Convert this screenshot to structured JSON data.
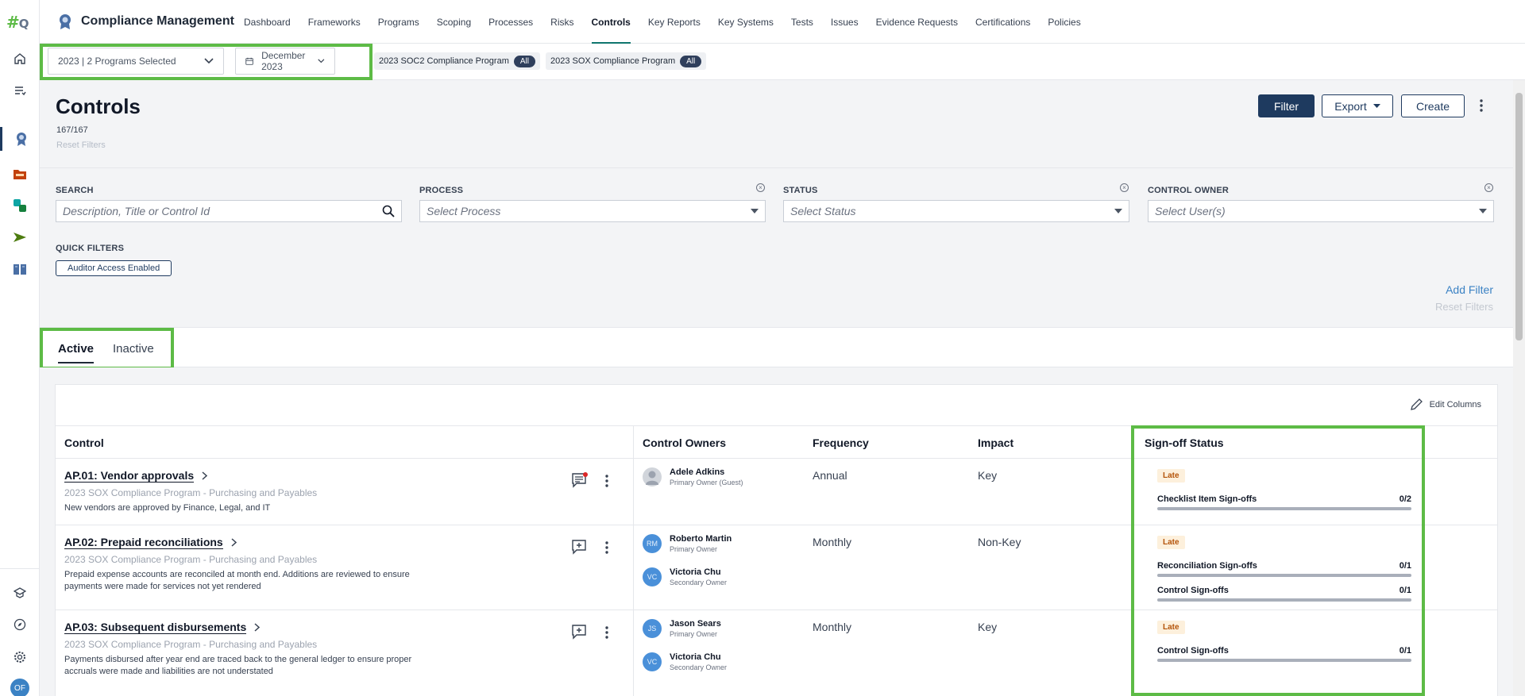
{
  "app": {
    "title": "Compliance Management",
    "nav": [
      "Dashboard",
      "Frameworks",
      "Programs",
      "Scoping",
      "Processes",
      "Risks",
      "Controls",
      "Key Reports",
      "Key Systems",
      "Tests",
      "Issues",
      "Evidence Requests",
      "Certifications",
      "Policies"
    ],
    "active_nav": "Controls",
    "user_initials": "OF"
  },
  "program_bar": {
    "program_select": "2023 | 2 Programs Selected",
    "period_select": "December 2023",
    "chips": [
      {
        "label": "2023 SOC2 Compliance Program",
        "pill": "All"
      },
      {
        "label": "2023 SOX Compliance Program",
        "pill": "All"
      }
    ]
  },
  "header": {
    "title": "Controls",
    "count": "167/167",
    "reset": "Reset Filters",
    "filter_btn": "Filter",
    "export_btn": "Export",
    "create_btn": "Create"
  },
  "filters": {
    "search_label": "SEARCH",
    "search_placeholder": "Description, Title or Control Id",
    "process_label": "PROCESS",
    "process_placeholder": "Select Process",
    "status_label": "STATUS",
    "status_placeholder": "Select Status",
    "owner_label": "CONTROL OWNER",
    "owner_placeholder": "Select User(s)",
    "quick_label": "QUICK FILTERS",
    "quick_btn": "Auditor Access Enabled",
    "add_filter": "Add Filter",
    "reset_filters": "Reset Filters"
  },
  "tabs": {
    "active": "Active",
    "inactive": "Inactive"
  },
  "table": {
    "edit_columns": "Edit Columns",
    "headers": {
      "control": "Control",
      "owners": "Control Owners",
      "frequency": "Frequency",
      "impact": "Impact",
      "signoff": "Sign-off Status"
    },
    "rows": [
      {
        "title": "AP.01: Vendor approvals",
        "program": "2023 SOX Compliance Program - Purchasing and Payables",
        "desc": "New vendors are approved by Finance, Legal, and IT",
        "owners": [
          {
            "initials": "",
            "name": "Adele Adkins",
            "role": "Primary Owner (Guest)"
          }
        ],
        "frequency": "Annual",
        "impact": "Key",
        "status": "Late",
        "signoffs": [
          {
            "label": "Checklist Item Sign-offs",
            "value": "0/2"
          }
        ]
      },
      {
        "title": "AP.02: Prepaid reconciliations",
        "program": "2023 SOX Compliance Program - Purchasing and Payables",
        "desc": "Prepaid expense accounts are reconciled at month end. Additions are reviewed to ensure payments were made for services not yet rendered",
        "owners": [
          {
            "initials": "RM",
            "name": "Roberto Martin",
            "role": "Primary Owner"
          },
          {
            "initials": "VC",
            "name": "Victoria Chu",
            "role": "Secondary Owner"
          }
        ],
        "frequency": "Monthly",
        "impact": "Non-Key",
        "status": "Late",
        "signoffs": [
          {
            "label": "Reconciliation Sign-offs",
            "value": "0/1"
          },
          {
            "label": "Control Sign-offs",
            "value": "0/1"
          }
        ]
      },
      {
        "title": "AP.03: Subsequent disbursements",
        "program": "2023 SOX Compliance Program - Purchasing and Payables",
        "desc": "Payments disbursed after year end are traced back to the general ledger to ensure proper accruals were made and liabilities are not understated",
        "owners": [
          {
            "initials": "JS",
            "name": "Jason Sears",
            "role": "Primary Owner"
          },
          {
            "initials": "VC",
            "name": "Victoria Chu",
            "role": "Secondary Owner"
          }
        ],
        "frequency": "Monthly",
        "impact": "Key",
        "status": "Late",
        "signoffs": [
          {
            "label": "Control Sign-offs",
            "value": "0/1"
          }
        ]
      }
    ]
  },
  "colors": {
    "primary": "#1e3a5f",
    "highlight": "#5dbb46",
    "late_bg": "#fdf0dc",
    "late_fg": "#b45309",
    "avatar": "#4a90d9"
  }
}
